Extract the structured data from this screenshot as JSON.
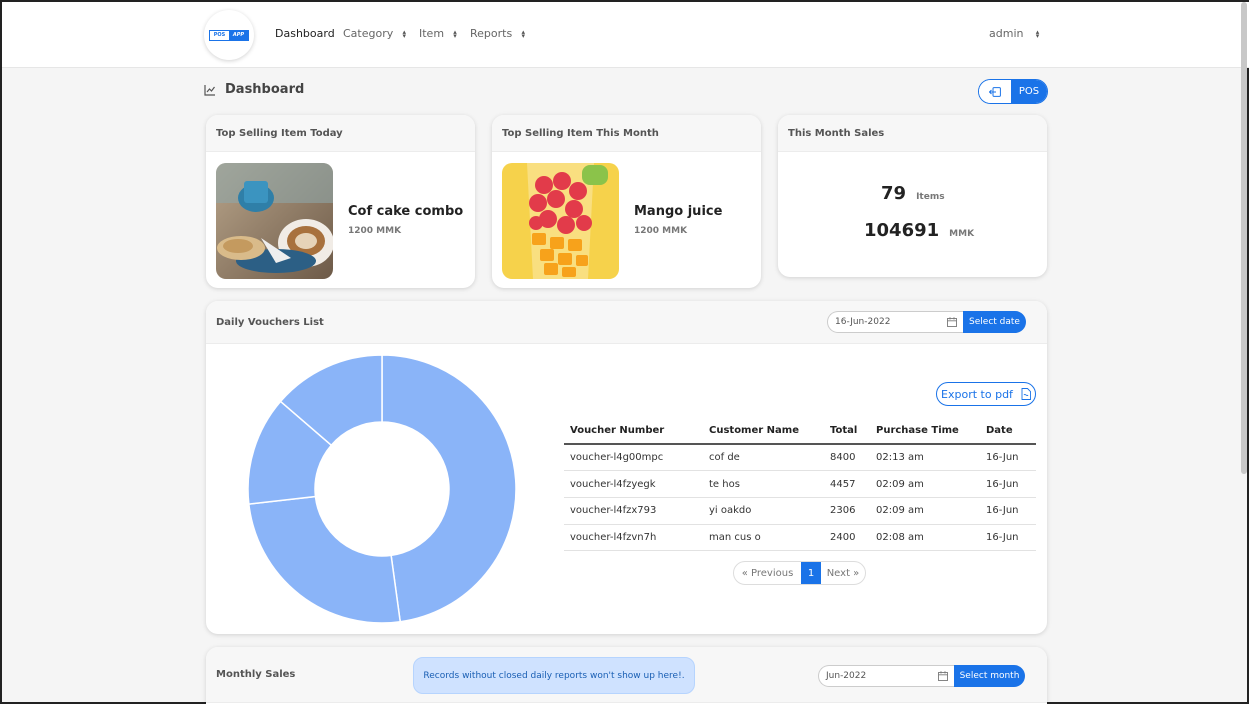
{
  "nav": {
    "logo_left": "POS",
    "logo_right": "APP",
    "items": [
      {
        "label": "Dashboard"
      },
      {
        "label": "Category"
      },
      {
        "label": "Item"
      },
      {
        "label": "Reports"
      }
    ],
    "user": "admin"
  },
  "page": {
    "title": "Dashboard",
    "pos_button": "POS"
  },
  "cards": {
    "today": {
      "title": "Top Selling Item Today",
      "item_name": "Cof cake combo",
      "item_price": "1200 MMK"
    },
    "month": {
      "title": "Top Selling Item This Month",
      "item_name": "Mango juice",
      "item_price": "1200 MMK"
    },
    "sales": {
      "title": "This Month Sales",
      "items_count": "79",
      "items_unit": "Items",
      "amount": "104691",
      "amount_unit": "MMK"
    }
  },
  "vouchers": {
    "title": "Daily Vouchers List",
    "date_value": "16-Jun-2022",
    "select_date_label": "Select date",
    "export_label": "Export to pdf",
    "columns": [
      "Voucher Number",
      "Customer Name",
      "Total",
      "Purchase Time",
      "Date"
    ],
    "rows": [
      [
        "voucher-l4g00mpc",
        "cof de",
        "8400",
        "02:13 am",
        "16-Jun"
      ],
      [
        "voucher-l4fzyegk",
        "te hos",
        "4457",
        "02:09 am",
        "16-Jun"
      ],
      [
        "voucher-l4fzx793",
        "yi oakdo",
        "2306",
        "02:09 am",
        "16-Jun"
      ],
      [
        "voucher-l4fzvn7h",
        "man cus o",
        "2400",
        "02:08 am",
        "16-Jun"
      ]
    ],
    "pager": {
      "prev": "« Previous",
      "current": "1",
      "next": "Next »"
    }
  },
  "chart_data": {
    "type": "pie",
    "variant": "doughnut",
    "categories": [
      "voucher-l4g00mpc",
      "voucher-l4fzyegk",
      "voucher-l4fzx793",
      "voucher-l4fzvn7h"
    ],
    "values": [
      8400,
      4457,
      2306,
      2400
    ],
    "color": "#8ab4f8"
  },
  "monthly": {
    "title": "Monthly Sales",
    "notice": "Records without closed daily reports won't show up here!.",
    "month_value": "Jun-2022",
    "select_month_label": "Select month"
  }
}
